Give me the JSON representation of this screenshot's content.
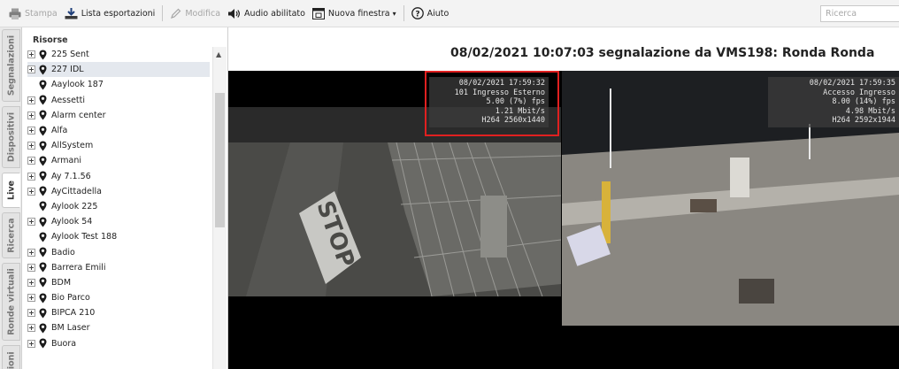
{
  "toolbar": {
    "print": "Stampa",
    "export_list": "Lista esportazioni",
    "edit": "Modifica",
    "audio": "Audio abilitato",
    "new_window": "Nuova finestra",
    "new_window_caret": "▾",
    "help": "Aiuto"
  },
  "search": {
    "placeholder": "Ricerca"
  },
  "tabs": [
    "Segnalazioni",
    "Dispositivi",
    "Live",
    "Ricerca",
    "Ronde virtuali",
    "Azioni"
  ],
  "tabs_visible": [
    "Segnalazioni",
    "Dispositivi",
    "Live",
    "Ricerca",
    "Ronde virtuali",
    "zioni"
  ],
  "tree": {
    "header": "Risorse",
    "items": [
      {
        "label": "225 Sent",
        "expandable": true
      },
      {
        "label": "227 IDL",
        "expandable": true,
        "selected": true
      },
      {
        "label": "Aaylook 187",
        "expandable": false
      },
      {
        "label": "Aessetti",
        "expandable": true
      },
      {
        "label": "Alarm center",
        "expandable": true
      },
      {
        "label": "Alfa",
        "expandable": true
      },
      {
        "label": "AllSystem",
        "expandable": true
      },
      {
        "label": "Armani",
        "expandable": true
      },
      {
        "label": "Ay 7.1.56",
        "expandable": true
      },
      {
        "label": "AyCittadella",
        "expandable": true
      },
      {
        "label": "Aylook 225",
        "expandable": false
      },
      {
        "label": "Aylook 54",
        "expandable": true
      },
      {
        "label": "Aylook Test 188",
        "expandable": false
      },
      {
        "label": "Badio",
        "expandable": true
      },
      {
        "label": "Barrera Emili",
        "expandable": true
      },
      {
        "label": "BDM",
        "expandable": true
      },
      {
        "label": "Bio Parco",
        "expandable": true
      },
      {
        "label": "BIPCA 210",
        "expandable": true
      },
      {
        "label": "BM Laser",
        "expandable": true
      },
      {
        "label": "Buora",
        "expandable": true
      }
    ]
  },
  "main": {
    "title": "08/02/2021 10:07:03 segnalazione da VMS198: Ronda Ronda",
    "cameras": [
      {
        "osd": [
          "08/02/2021 17:59:32",
          "101 Ingresso Esterno",
          "5.00 (7%) fps",
          "1.21 Mbit/s",
          "H264 2560x1440"
        ],
        "highlighted": true
      },
      {
        "osd": [
          "08/02/2021 17:59:35",
          "Accesso Ingresso",
          "8.00 (14%) fps",
          "4.98 Mbit/s",
          "H264 2592x1944"
        ],
        "highlighted": false
      }
    ]
  },
  "colors": {
    "highlight": "#e02020",
    "selection": "#e4e8ee",
    "video_bg": "#000000"
  }
}
